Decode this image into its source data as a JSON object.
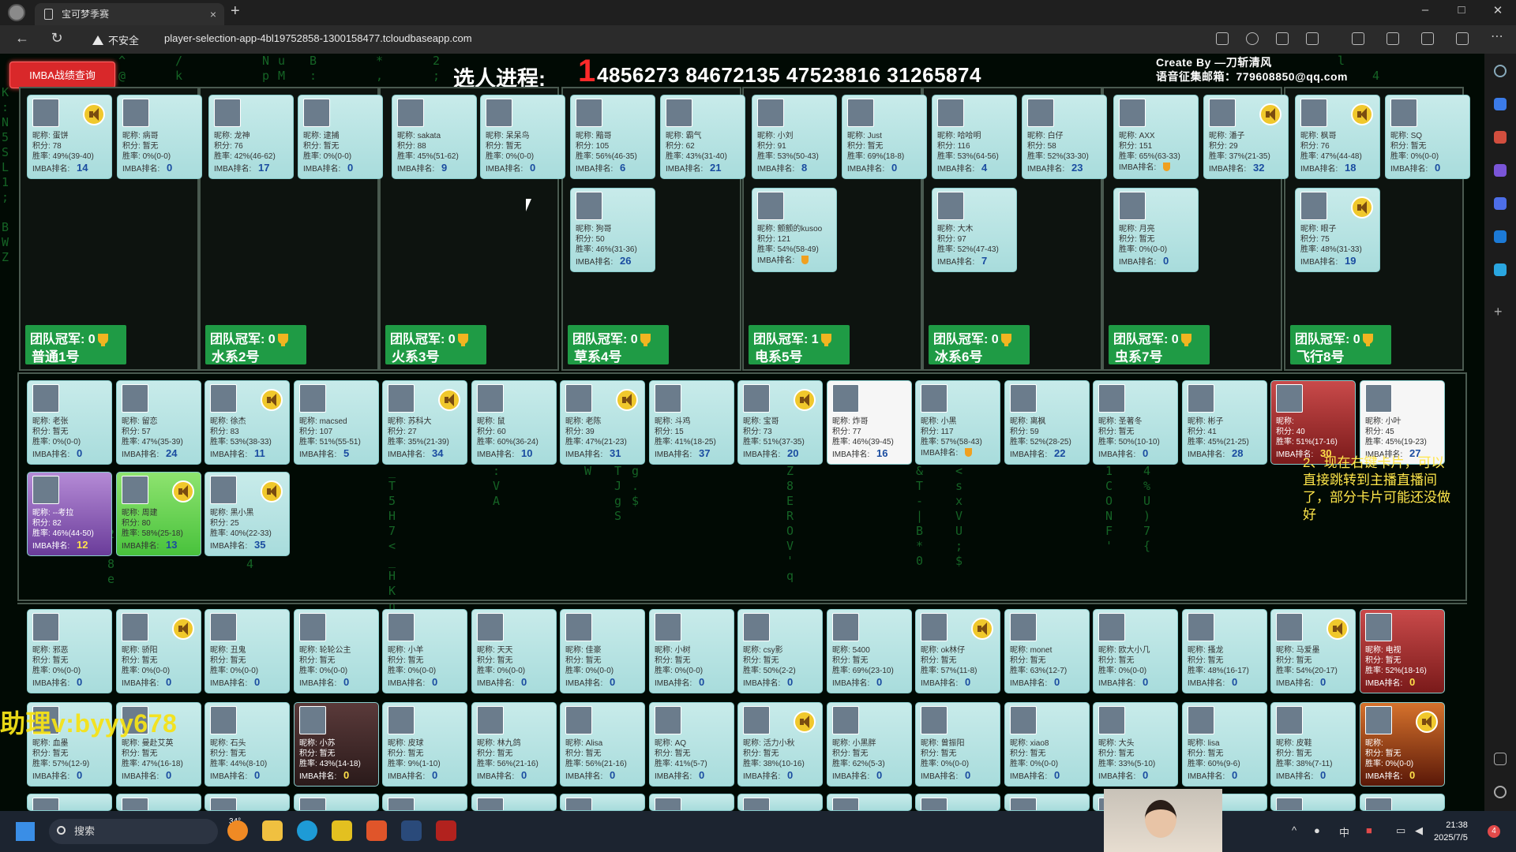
{
  "browser": {
    "tab_title": "宝可梦季赛",
    "tab_close": "×",
    "new_tab": "+",
    "security": "不安全",
    "url": "player-selection-app-4bl19752858-1300158477.tcloudbaseapp.com",
    "win_min": "–",
    "win_max": "□",
    "win_close": "✕"
  },
  "header": {
    "imba_button": "IMBA战绩查询",
    "progress_label": "选人进程:",
    "progress_value": "1",
    "codes": "4856273 84672135 47523816 31265874",
    "creator_line1": "Create By —刀斩清风",
    "creator_line2": "语音征集邮箱：779608850@qq.com"
  },
  "labels": {
    "nick": "昵称: ",
    "score": "积分: ",
    "winrate": "胜率: ",
    "rank": "IMBA排名: ",
    "team_champion": "团队冠军: "
  },
  "teams": [
    {
      "name": "普通1号",
      "champ": "0"
    },
    {
      "name": "水系2号",
      "champ": "0"
    },
    {
      "name": "火系3号",
      "champ": "0"
    },
    {
      "name": "草系4号",
      "champ": "0"
    },
    {
      "name": "电系5号",
      "champ": "1"
    },
    {
      "name": "冰系6号",
      "champ": "0"
    },
    {
      "name": "虫系7号",
      "champ": "0"
    },
    {
      "name": "飞行8号",
      "champ": "0"
    }
  ],
  "team_players": [
    {
      "n": "蛋饼",
      "s": "78",
      "w": "49%(39-40)",
      "r": "14",
      "snd": true
    },
    {
      "n": "病哥",
      "s": "暂无",
      "w": "0%(0-0)",
      "r": "0"
    },
    {
      "n": "龙神",
      "s": "76",
      "w": "42%(46-62)",
      "r": "17"
    },
    {
      "n": "逮捕",
      "s": "暂无",
      "w": "0%(0-0)",
      "r": "0"
    },
    {
      "n": "sakata",
      "s": "88",
      "w": "45%(51-62)",
      "r": "9"
    },
    {
      "n": "呆呆鸟",
      "s": "暂无",
      "w": "0%(0-0)",
      "r": "0"
    },
    {
      "n": "黯哥",
      "s": "105",
      "w": "56%(46-35)",
      "r": "6"
    },
    {
      "n": "霸气",
      "s": "62",
      "w": "43%(31-40)",
      "r": "21"
    },
    {
      "n": "狗哥",
      "s": "50",
      "w": "46%(31-36)",
      "r": "26"
    },
    {
      "n": "小刘",
      "s": "91",
      "w": "53%(50-43)",
      "r": "8"
    },
    {
      "n": "Just",
      "s": "暂无",
      "w": "69%(18-8)",
      "r": "0"
    },
    {
      "n": "颤颤的kusoo",
      "s": "121",
      "w": "54%(58-49)",
      "r": "",
      "medal": true
    },
    {
      "n": "哈哈明",
      "s": "116",
      "w": "53%(64-56)",
      "r": "4"
    },
    {
      "n": "白仔",
      "s": "58",
      "w": "52%(33-30)",
      "r": "23"
    },
    {
      "n": "大木",
      "s": "97",
      "w": "52%(47-43)",
      "r": "7"
    },
    {
      "n": "AXX",
      "s": "151",
      "w": "65%(63-33)",
      "r": "",
      "medal": true
    },
    {
      "n": "潘子",
      "s": "29",
      "w": "37%(21-35)",
      "r": "32",
      "snd": true
    },
    {
      "n": "月亮",
      "s": "暂无",
      "w": "0%(0-0)",
      "r": "0"
    },
    {
      "n": "枫哥",
      "s": "76",
      "w": "47%(44-48)",
      "r": "18",
      "snd": true
    },
    {
      "n": "SQ",
      "s": "暂无",
      "w": "0%(0-0)",
      "r": "0"
    },
    {
      "n": "眼子",
      "s": "75",
      "w": "48%(31-33)",
      "r": "19",
      "snd": true
    }
  ],
  "pool_players": [
    {
      "n": "老张",
      "s": "暂无",
      "w": "0%(0-0)",
      "r": "0"
    },
    {
      "n": "留恋",
      "s": "57",
      "w": "47%(35-39)",
      "r": "24"
    },
    {
      "n": "徐杰",
      "s": "83",
      "w": "53%(38-33)",
      "r": "11",
      "snd": true
    },
    {
      "n": "macsed",
      "s": "107",
      "w": "51%(55-51)",
      "r": "5"
    },
    {
      "n": "苏科大",
      "s": "27",
      "w": "35%(21-39)",
      "r": "34",
      "snd": true
    },
    {
      "n": "鼠",
      "s": "60",
      "w": "60%(36-24)",
      "r": "10"
    },
    {
      "n": "老陈",
      "s": "39",
      "w": "47%(21-23)",
      "r": "31",
      "snd": true
    },
    {
      "n": "斗鸡",
      "s": "15",
      "w": "41%(18-25)",
      "r": "37"
    },
    {
      "n": "宝哥",
      "s": "73",
      "w": "51%(37-35)",
      "r": "20",
      "snd": true
    },
    {
      "n": "炸哥",
      "s": "77",
      "w": "46%(39-45)",
      "r": "16"
    },
    {
      "n": "小黑",
      "s": "117",
      "w": "57%(58-43)",
      "r": "",
      "medal": true
    },
    {
      "n": "离枫",
      "s": "59",
      "w": "52%(28-25)",
      "r": "22"
    },
    {
      "n": "圣著冬",
      "s": "暂无",
      "w": "50%(10-10)",
      "r": "0"
    },
    {
      "n": "彬子",
      "s": "41",
      "w": "45%(21-25)",
      "r": "28"
    },
    {
      "n": "",
      "s": "40",
      "w": "51%(17-16)",
      "r": "30"
    },
    {
      "n": "小叶",
      "s": "45",
      "w": "45%(19-23)",
      "r": "27"
    },
    {
      "n": "--考拉",
      "s": "82",
      "w": "46%(44-50)",
      "r": "12"
    },
    {
      "n": "周建",
      "s": "80",
      "w": "58%(25-18)",
      "r": "13",
      "snd": true
    },
    {
      "n": "黑小黑",
      "s": "25",
      "w": "40%(22-33)",
      "r": "35",
      "snd": true
    }
  ],
  "bench_players": [
    {
      "n": "邪恶",
      "s": "暂无",
      "w": "0%(0-0)",
      "r": "0"
    },
    {
      "n": "骄阳",
      "s": "暂无",
      "w": "0%(0-0)",
      "r": "0",
      "snd": true
    },
    {
      "n": "丑鬼",
      "s": "暂无",
      "w": "0%(0-0)",
      "r": "0"
    },
    {
      "n": "轮轮公主",
      "s": "暂无",
      "w": "0%(0-0)",
      "r": "0"
    },
    {
      "n": "小羊",
      "s": "暂无",
      "w": "0%(0-0)",
      "r": "0"
    },
    {
      "n": "天天",
      "s": "暂无",
      "w": "0%(0-0)",
      "r": "0"
    },
    {
      "n": "佳豪",
      "s": "暂无",
      "w": "0%(0-0)",
      "r": "0"
    },
    {
      "n": "小树",
      "s": "暂无",
      "w": "0%(0-0)",
      "r": "0"
    },
    {
      "n": "csy影",
      "s": "暂无",
      "w": "50%(2-2)",
      "r": "0"
    },
    {
      "n": "5400",
      "s": "暂无",
      "w": "69%(23-10)",
      "r": "0"
    },
    {
      "n": "ok林仔",
      "s": "暂无",
      "w": "57%(11-8)",
      "r": "0",
      "snd": true
    },
    {
      "n": "monet",
      "s": "暂无",
      "w": "63%(12-7)",
      "r": "0"
    },
    {
      "n": "欧大小几",
      "s": "暂无",
      "w": "0%(0-0)",
      "r": "0"
    },
    {
      "n": "搔龙",
      "s": "暂无",
      "w": "48%(16-17)",
      "r": "0"
    },
    {
      "n": "马爱墨",
      "s": "暂无",
      "w": "54%(20-17)",
      "r": "0",
      "snd": true
    },
    {
      "n": "电视",
      "s": "暂无",
      "w": "52%(18-16)",
      "r": "0"
    },
    {
      "n": "血墨",
      "s": "暂无",
      "w": "57%(12-9)",
      "r": "0"
    },
    {
      "n": "曼赴艾英",
      "s": "暂无",
      "w": "47%(16-18)",
      "r": "0"
    },
    {
      "n": "石头",
      "s": "暂无",
      "w": "44%(8-10)",
      "r": "0"
    },
    {
      "n": "小苏",
      "s": "暂无",
      "w": "43%(14-18)",
      "r": "0"
    },
    {
      "n": "皮球",
      "s": "暂无",
      "w": "9%(1-10)",
      "r": "0"
    },
    {
      "n": "林九鸽",
      "s": "暂无",
      "w": "56%(21-16)",
      "r": "0"
    },
    {
      "n": "Alisa",
      "s": "暂无",
      "w": "56%(21-16)",
      "r": "0"
    },
    {
      "n": "AQ",
      "s": "暂无",
      "w": "41%(5-7)",
      "r": "0"
    },
    {
      "n": "活力小秋",
      "s": "暂无",
      "w": "38%(10-16)",
      "r": "0",
      "snd": true
    },
    {
      "n": "小黑胖",
      "s": "暂无",
      "w": "62%(5-3)",
      "r": "0"
    },
    {
      "n": "曾振阳",
      "s": "暂无",
      "w": "0%(0-0)",
      "r": "0"
    },
    {
      "n": "xiao8",
      "s": "暂无",
      "w": "0%(0-0)",
      "r": "0"
    },
    {
      "n": "大头",
      "s": "暂无",
      "w": "33%(5-10)",
      "r": "0"
    },
    {
      "n": "lisa",
      "s": "暂无",
      "w": "60%(9-6)",
      "r": "0"
    },
    {
      "n": "皮鞋",
      "s": "暂无",
      "w": "38%(7-11)",
      "r": "0"
    },
    {
      "n": "",
      "s": "暂无",
      "w": "0%(0-0)",
      "r": "0",
      "snd": true
    }
  ],
  "overlay": {
    "note": "2、现在右键卡片，可以直接跳转到主播直播间了，部分卡片可能还没做好",
    "watermark": "助理v:byyy678"
  },
  "taskbar": {
    "search_placeholder": "搜索",
    "temperature": "34°",
    "time": "21:38",
    "date": "2025/7/5",
    "ime": "中",
    "notifications": "4"
  }
}
